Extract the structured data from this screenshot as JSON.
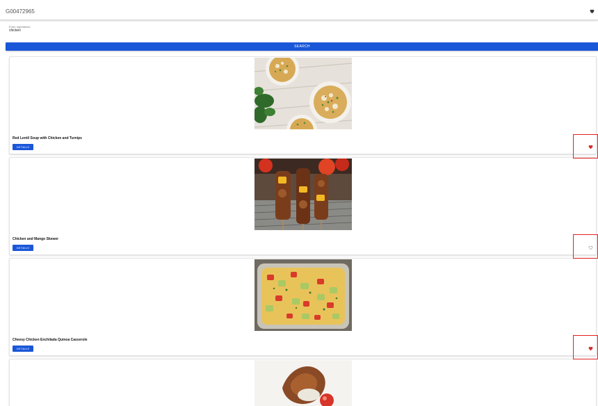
{
  "app": {
    "title": "G00472965"
  },
  "search": {
    "label": "Enter Ingredients",
    "value": "chicken",
    "button_label": "SEARCH"
  },
  "recipes": [
    {
      "title": "Red Lentil Soup with Chicken and Turnips",
      "details_label": "DETAILS",
      "favorite": true,
      "image": "lentil-soup-bowls"
    },
    {
      "title": "Chicken and Mango Skewer",
      "details_label": "DETAILS",
      "favorite": false,
      "image": "chicken-skewers"
    },
    {
      "title": "Cheesy Chicken Enchilada Quinoa Casserole",
      "details_label": "DETAILS",
      "favorite": true,
      "image": "quinoa-casserole"
    },
    {
      "title": "",
      "details_label": "",
      "favorite": false,
      "image": "chicken-dish"
    }
  ],
  "icons": {
    "favorite_filled": "heart-filled-icon",
    "favorite_outline": "heart-outline-icon"
  },
  "colors": {
    "primary": "#1a57d8",
    "favorite": "#d32f2f",
    "highlight": "#e32020"
  }
}
